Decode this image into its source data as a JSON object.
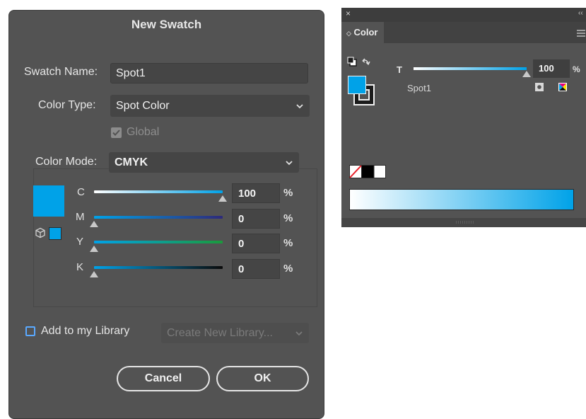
{
  "dialog": {
    "title": "New Swatch",
    "swatch_name_label": "Swatch Name:",
    "swatch_name_value": "Spot1",
    "color_type_label": "Color Type:",
    "color_type_value": "Spot Color",
    "global_label": "Global",
    "color_mode_label": "Color Mode:",
    "color_mode_value": "CMYK",
    "channels": [
      {
        "label": "C",
        "value": "100",
        "unit": "%",
        "level": 1.0
      },
      {
        "label": "M",
        "value": "0",
        "unit": "%",
        "level": 0.0
      },
      {
        "label": "Y",
        "value": "0",
        "unit": "%",
        "level": 0.0
      },
      {
        "label": "K",
        "value": "0",
        "unit": "%",
        "level": 0.0
      }
    ],
    "add_library_label": "Add to my Library",
    "library_select": "Create New Library...",
    "cancel_label": "Cancel",
    "ok_label": "OK"
  },
  "panel": {
    "close_glyph": "×",
    "collapse_glyph": "‹‹",
    "tab_label": "Color",
    "tint_label": "T",
    "tint_value": "100",
    "tint_unit": "%",
    "tint_level": 1.0,
    "swatch_name": "Spot1"
  },
  "colors": {
    "accent": "#00a2e8",
    "dialog_bg": "#535353"
  }
}
